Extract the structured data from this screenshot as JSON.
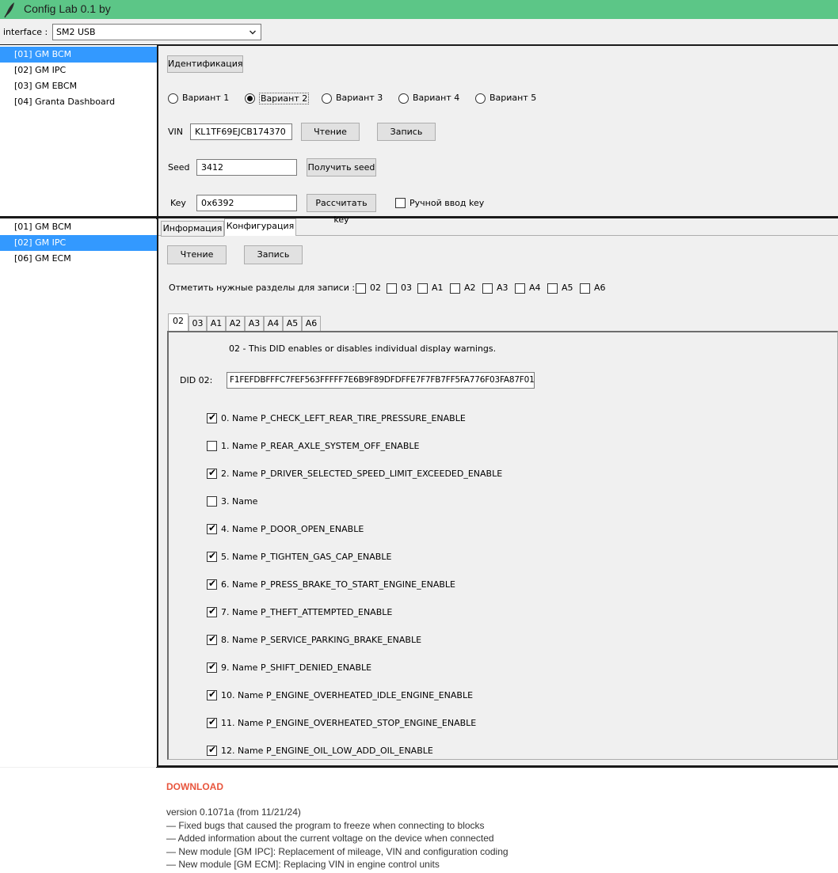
{
  "window": {
    "title": "Config Lab 0.1 by"
  },
  "interface": {
    "label": "interface :",
    "value": "SM2 USB"
  },
  "top_list": {
    "items": [
      {
        "label": "[01] GM BCM",
        "selected": true
      },
      {
        "label": "[02] GM IPC",
        "selected": false
      },
      {
        "label": "[03] GM EBCM",
        "selected": false
      },
      {
        "label": "[04] Granta Dashboard",
        "selected": false
      }
    ]
  },
  "bottom_list": {
    "items": [
      {
        "label": "[01] GM BCM",
        "selected": false
      },
      {
        "label": "[02] GM IPC",
        "selected": true
      },
      {
        "label": "[06] GM ECM",
        "selected": false
      }
    ]
  },
  "ident": {
    "button": "Идентификация",
    "variants": [
      {
        "label": "Вариант 1",
        "selected": false
      },
      {
        "label": "Вариант 2",
        "selected": true
      },
      {
        "label": "Вариант 3",
        "selected": false
      },
      {
        "label": "Вариант 4",
        "selected": false
      },
      {
        "label": "Вариант 5",
        "selected": false
      }
    ],
    "vin_label": "VIN",
    "vin_value": "KL1TF69EJCB174370",
    "read_button": "Чтение",
    "write_button": "Запись",
    "seed_label": "Seed",
    "seed_value": "3412",
    "get_seed_button": "Получить seed",
    "key_label": "Key",
    "key_value": "0x6392",
    "calc_key_button": "Рассчитать key",
    "manual_key_label": "Ручной ввод key",
    "manual_key_checked": false
  },
  "tabs": [
    {
      "label": "Информация",
      "active": false
    },
    {
      "label": "Конфигурация",
      "active": true
    }
  ],
  "config": {
    "read_button": "Чтение",
    "write_button": "Запись",
    "sections_label": "Отметить нужные разделы для записи :",
    "sections": [
      {
        "label": "02",
        "checked": false
      },
      {
        "label": "03",
        "checked": false
      },
      {
        "label": "A1",
        "checked": false
      },
      {
        "label": "A2",
        "checked": false
      },
      {
        "label": "A3",
        "checked": false
      },
      {
        "label": "A4",
        "checked": false
      },
      {
        "label": "A5",
        "checked": false
      },
      {
        "label": "A6",
        "checked": false
      }
    ],
    "did_tabs": [
      {
        "label": "02",
        "active": true
      },
      {
        "label": "03",
        "active": false
      },
      {
        "label": "A1",
        "active": false
      },
      {
        "label": "A2",
        "active": false
      },
      {
        "label": "A3",
        "active": false
      },
      {
        "label": "A4",
        "active": false
      },
      {
        "label": "A5",
        "active": false
      },
      {
        "label": "A6",
        "active": false
      }
    ],
    "did_description": "02 - This DID enables or disables individual display warnings.",
    "did_label": "DID 02:",
    "did_value": "F1FEFDBFFFC7FEF563FFFFF7E6B9F89DFDFFE7F7FB7FF5FA776F03FA87F01",
    "items": [
      {
        "label": "0. Name P_CHECK_LEFT_REAR_TIRE_PRESSURE_ENABLE",
        "checked": true
      },
      {
        "label": "1. Name P_REAR_AXLE_SYSTEM_OFF_ENABLE",
        "checked": false
      },
      {
        "label": "2. Name P_DRIVER_SELECTED_SPEED_LIMIT_EXCEEDED_ENABLE",
        "checked": true
      },
      {
        "label": "3. Name",
        "checked": false
      },
      {
        "label": "4. Name P_DOOR_OPEN_ENABLE",
        "checked": true
      },
      {
        "label": "5. Name P_TIGHTEN_GAS_CAP_ENABLE",
        "checked": true
      },
      {
        "label": "6. Name P_PRESS_BRAKE_TO_START_ENGINE_ENABLE",
        "checked": true
      },
      {
        "label": "7. Name P_THEFT_ATTEMPTED_ENABLE",
        "checked": true
      },
      {
        "label": "8. Name P_SERVICE_PARKING_BRAKE_ENABLE",
        "checked": true
      },
      {
        "label": "9. Name P_SHIFT_DENIED_ENABLE",
        "checked": true
      },
      {
        "label": "10. Name P_ENGINE_OVERHEATED_IDLE_ENGINE_ENABLE",
        "checked": true
      },
      {
        "label": "11. Name P_ENGINE_OVERHEATED_STOP_ENGINE_ENABLE",
        "checked": true
      },
      {
        "label": "12. Name P_ENGINE_OIL_LOW_ADD_OIL_ENABLE",
        "checked": true
      }
    ]
  },
  "download_label": "DOWNLOAD",
  "changelog": [
    "version 0.1071a (from 11/21/24)",
    "— Fixed bugs that caused the program to freeze when connecting to blocks",
    "— Added information about the current voltage on the device when connected",
    "— New module [GM IPC]: Replacement of mileage, VIN and configuration coding",
    "— New module [GM ECM]: Replacing VIN in engine control units"
  ],
  "colors": {
    "titlebar": "#5cc687",
    "selection": "#3399ff",
    "download": "#e8553d"
  },
  "icons": {
    "app": "feather-icon",
    "dropdown": "chevron-down-icon"
  }
}
